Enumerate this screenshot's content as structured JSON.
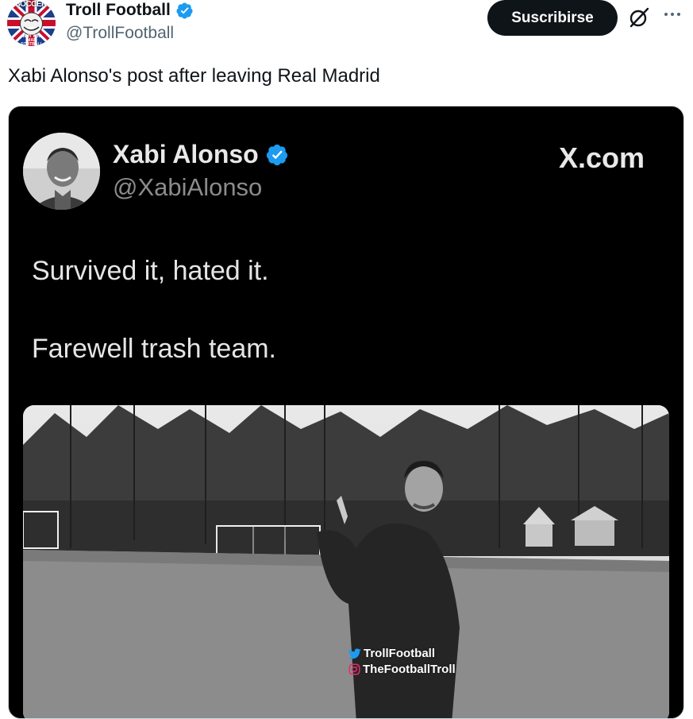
{
  "author": {
    "name": "Troll Football",
    "handle": "@TrollFootball",
    "avatar_icon": "troll-football-logo",
    "avatar_text_top": "SOCCER",
    "avatar_text_bottom": "WHY YOU MAD FOOTBALL"
  },
  "actions": {
    "subscribe_label": "Suscribirse",
    "grok_icon": "grok-icon",
    "more_icon": "more-icon"
  },
  "post": {
    "text": "Xabi Alonso's post after leaving Real Madrid"
  },
  "media": {
    "inner_name": "Xabi Alonso",
    "inner_handle": "@XabiAlonso",
    "inner_site": "X.com",
    "lines": [
      "Survived it, hated it.",
      "Farewell trash team."
    ],
    "watermark_twitter": "TrollFootball",
    "watermark_instagram": "TheFootballTroll"
  },
  "colors": {
    "verified": "#1d9bf0",
    "subscribe_bg": "#0f1419",
    "secondary_text": "#536471"
  }
}
